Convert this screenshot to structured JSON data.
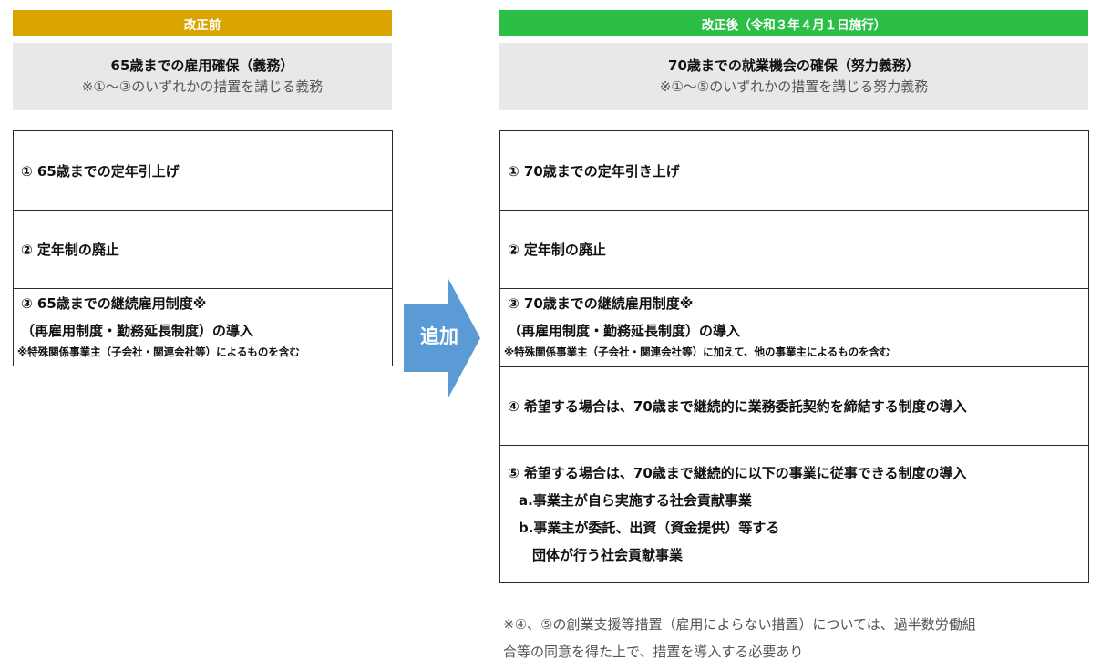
{
  "before": {
    "header": "改正前",
    "summary_title": "65歳までの雇用確保（義務）",
    "summary_sub": "※①～③のいずれかの措置を講じる義務",
    "items": [
      {
        "text": "① 65歳までの定年引上げ"
      },
      {
        "text": "② 定年制の廃止"
      },
      {
        "line1": "③  65歳までの継続雇用制度※",
        "line2": "（再雇用制度・勤務延長制度）の導入",
        "note": "※特殊関係事業主（子会社・関連会社等）によるものを含む"
      }
    ]
  },
  "arrow": {
    "label": "追加",
    "color": "#5b9bd5"
  },
  "after": {
    "header": "改正後（令和３年４月１日施行）",
    "summary_title": "70歳までの就業機会の確保（努力義務）",
    "summary_sub": "※①～⑤のいずれかの措置を講じる努力義務",
    "items": [
      {
        "text": "① 70歳までの定年引き上げ"
      },
      {
        "text": "② 定年制の廃止"
      },
      {
        "line1": "③ 70歳までの継続雇用制度※",
        "line2": "（再雇用制度・勤務延長制度）の導入",
        "note": "※特殊関係事業主（子会社・関連会社等）に加えて、他の事業主によるものを含む"
      },
      {
        "text": "④ 希望する場合は、70歳まで継続的に業務委託契約を締結する制度の導入"
      },
      {
        "line1": "⑤ 希望する場合は、70歳まで継続的に以下の事業に従事できる制度の導入",
        "line2": "a.事業主が自ら実施する社会貢献事業",
        "line3": "b.事業主が委託、出資（資金提供）等する",
        "line4": "団体が行う社会貢献事業"
      }
    ]
  },
  "footnote": {
    "line1": "※④、⑤の創業支援等措置（雇用によらない措置）については、過半数労働組",
    "line2": "合等の同意を得た上で、措置を導入する必要あり"
  },
  "colors": {
    "before_header": "#d9a400",
    "after_header": "#2dbe48",
    "summary_bg": "#e8e8e8"
  }
}
